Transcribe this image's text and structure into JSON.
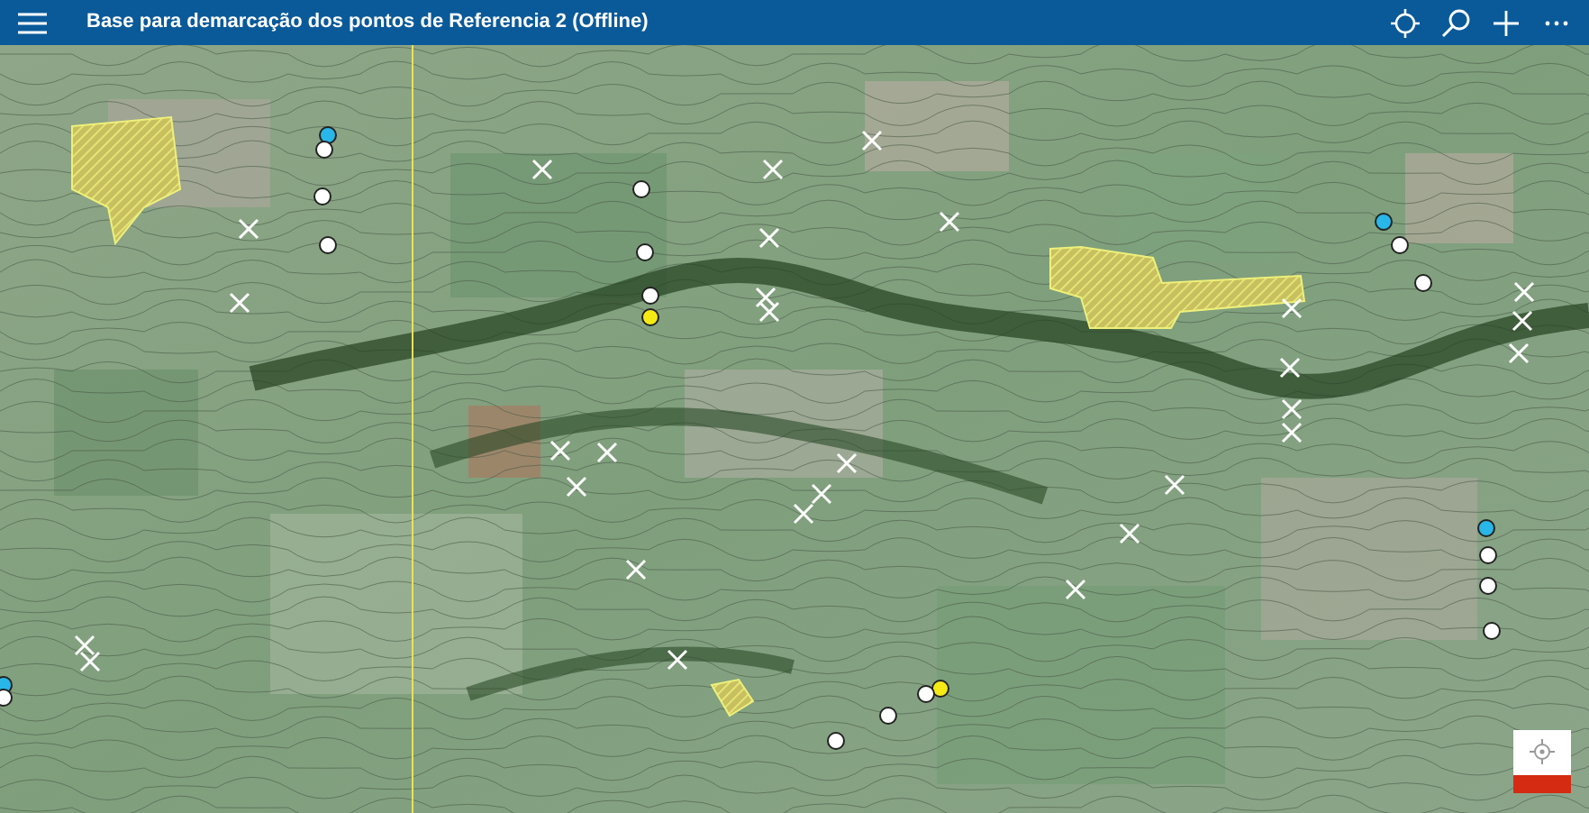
{
  "app_bar": {
    "title": "Base para demarcação dos pontos de Referencia 2 (Offline)"
  }
}
